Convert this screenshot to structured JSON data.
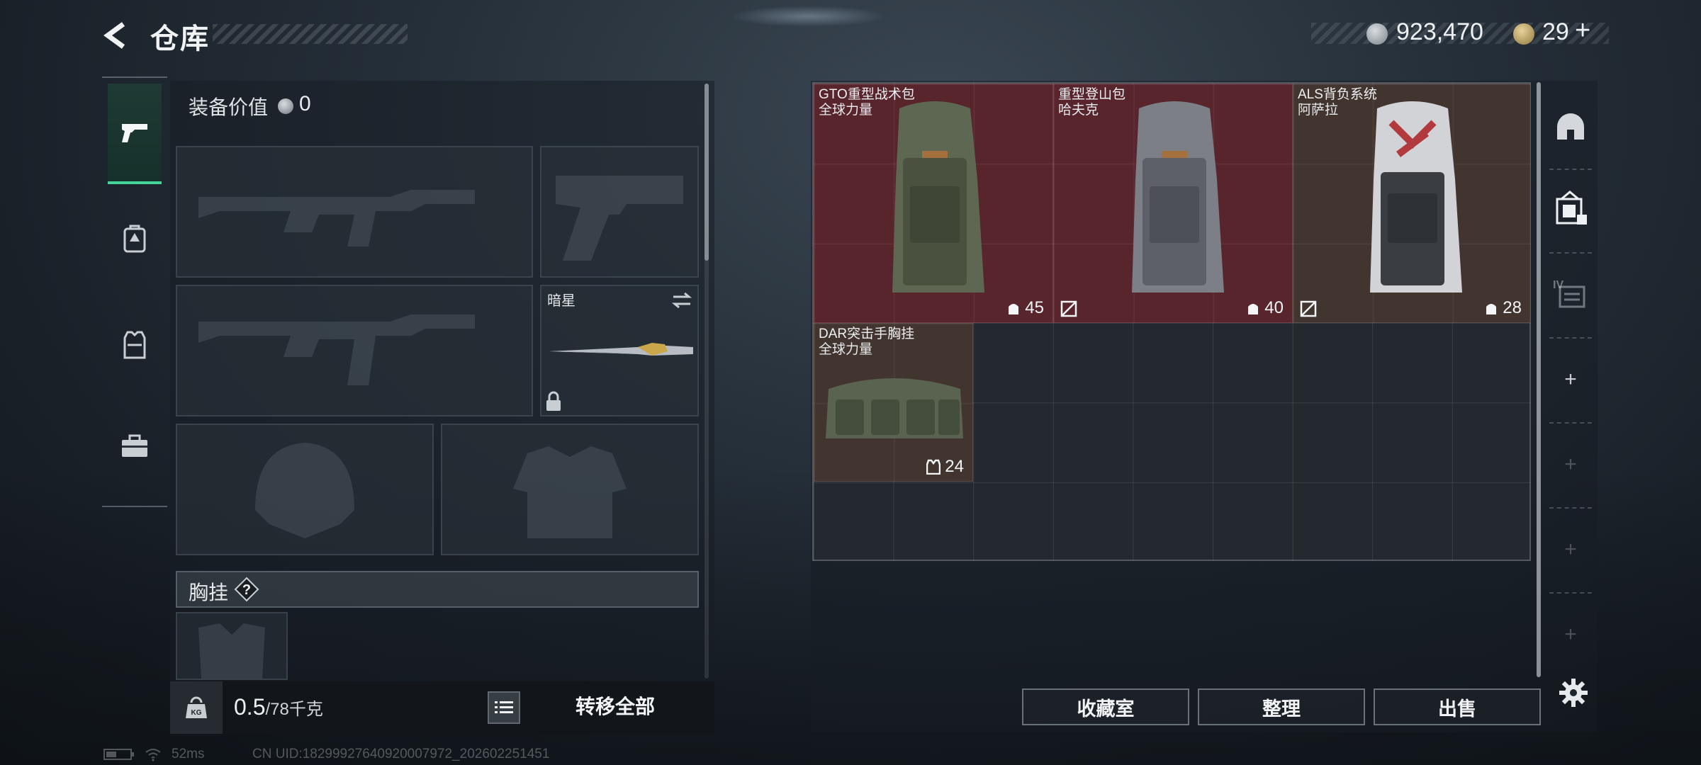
{
  "header": {
    "title": "仓库",
    "currency_silver": "923,470",
    "currency_gold": "29",
    "add_label": "+"
  },
  "left_tabs": [
    {
      "icon": "pistol-icon",
      "active": true
    },
    {
      "icon": "backpack-icon",
      "active": false
    },
    {
      "icon": "vest-icon",
      "active": false
    },
    {
      "icon": "toolbox-icon",
      "active": false
    }
  ],
  "equipment": {
    "value_label": "装备价值",
    "value": "0",
    "melee_slot_name": "暗星",
    "chest_label": "胸挂",
    "help_label": "?"
  },
  "weight": {
    "kg_icon_text": "KG",
    "current": "0.5",
    "capacity": "/78千克",
    "transfer_all": "转移全部"
  },
  "stash": {
    "items": [
      {
        "name": "GTO重型战术包",
        "sub": "全球力量",
        "capacity": "45",
        "color": "#6e242c"
      },
      {
        "name": "重型登山包",
        "sub": "哈夫克",
        "capacity": "40",
        "color": "#6e242c"
      },
      {
        "name": "ALS背负系统",
        "sub": "阿萨拉",
        "capacity": "28",
        "color": "#4e3a30"
      },
      {
        "name": "DAR突击手胸挂",
        "sub": "全球力量",
        "capacity": "24",
        "color": "#4e3a30"
      }
    ]
  },
  "actions": {
    "collection": "收藏室",
    "organize": "整理",
    "sell": "出售"
  },
  "status": {
    "ping": "52ms",
    "uid": "CN UID:1829992764092000797​2_202602251451"
  }
}
